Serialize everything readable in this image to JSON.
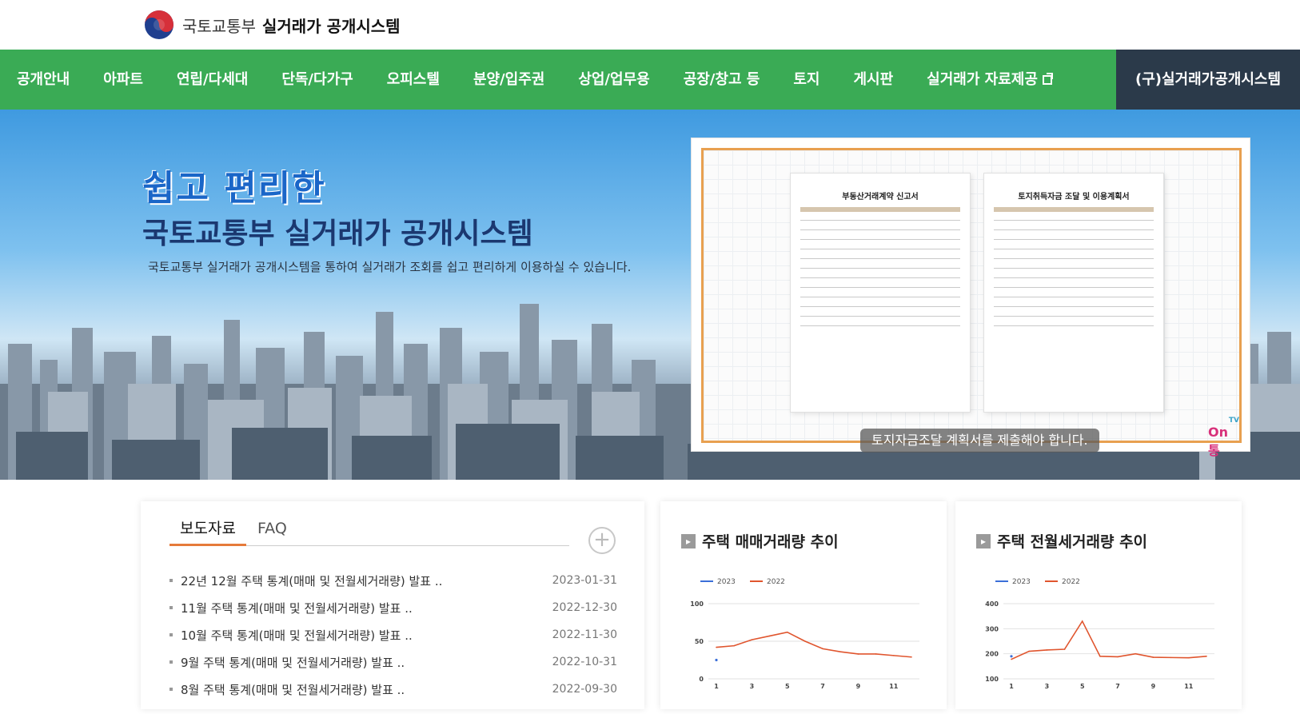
{
  "header": {
    "org": "국토교통부",
    "system": "실거래가 공개시스템"
  },
  "nav": {
    "items": [
      {
        "label": "공개안내"
      },
      {
        "label": "아파트"
      },
      {
        "label": "연립/다세대"
      },
      {
        "label": "단독/다가구"
      },
      {
        "label": "오피스텔"
      },
      {
        "label": "분양/입주권"
      },
      {
        "label": "상업/업무용"
      },
      {
        "label": "공장/창고 등"
      },
      {
        "label": "토지"
      },
      {
        "label": "게시판"
      },
      {
        "label": "실거래가 자료제공"
      }
    ],
    "old_system": "(구)실거래가공개시스템"
  },
  "banner": {
    "headline": "쉽고 편리한",
    "title": "국토교통부 실거래가 공개시스템",
    "subtitle": "국토교통부 실거래가 공개시스템을 통하여 실거래가 조회를 쉽고 편리하게 이용하실 수 있습니다."
  },
  "video": {
    "doc1_title": "부동산거래계약 신고서",
    "doc2_title": "토지취득자금 조달 및 이용계획서",
    "caption": "토지자금조달 계획서를 제출해야 합니다.",
    "badge_tv": "TV",
    "badge": "On통"
  },
  "news": {
    "tab_press": "보도자료",
    "tab_faq": "FAQ",
    "more": "+",
    "items": [
      {
        "title": "22년 12월 주택 통계(매매 및 전월세거래량) 발표 ..",
        "date": "2023-01-31"
      },
      {
        "title": "11월 주택 통계(매매 및 전월세거래량) 발표 ..",
        "date": "2022-12-30"
      },
      {
        "title": "10월 주택 통계(매매 및 전월세거래량) 발표 ..",
        "date": "2022-11-30"
      },
      {
        "title": "9월 주택 통계(매매 및 전월세거래량) 발표 ..",
        "date": "2022-10-31"
      },
      {
        "title": "8월 주택 통계(매매 및 전월세거래량) 발표 ..",
        "date": "2022-09-30"
      }
    ]
  },
  "colors": {
    "series_2023": "#3b6fd8",
    "series_2022": "#e0552e",
    "nav_green": "#3aab55"
  },
  "chart_data": [
    {
      "type": "line",
      "title": "주택 매매거래량 추이",
      "x": [
        1,
        2,
        3,
        4,
        5,
        6,
        7,
        8,
        9,
        10,
        11,
        12
      ],
      "xticks": [
        1,
        3,
        5,
        7,
        9,
        11
      ],
      "yticks": [
        0,
        50,
        100
      ],
      "ylim": [
        0,
        100
      ],
      "legend": "top-left",
      "series": [
        {
          "name": "2023",
          "values": [
            25
          ]
        },
        {
          "name": "2022",
          "values": [
            42,
            44,
            52,
            57,
            62,
            50,
            40,
            36,
            33,
            33,
            31,
            29
          ]
        }
      ]
    },
    {
      "type": "line",
      "title": "주택 전월세거래량 추이",
      "x": [
        1,
        2,
        3,
        4,
        5,
        6,
        7,
        8,
        9,
        10,
        11,
        12
      ],
      "xticks": [
        1,
        3,
        5,
        7,
        9,
        11
      ],
      "yticks": [
        100,
        200,
        300,
        400
      ],
      "ylim": [
        100,
        400
      ],
      "legend": "top-left",
      "series": [
        {
          "name": "2023",
          "values": [
            190
          ]
        },
        {
          "name": "2022",
          "values": [
            178,
            210,
            215,
            218,
            330,
            190,
            188,
            200,
            186,
            185,
            184,
            190
          ]
        }
      ]
    }
  ]
}
